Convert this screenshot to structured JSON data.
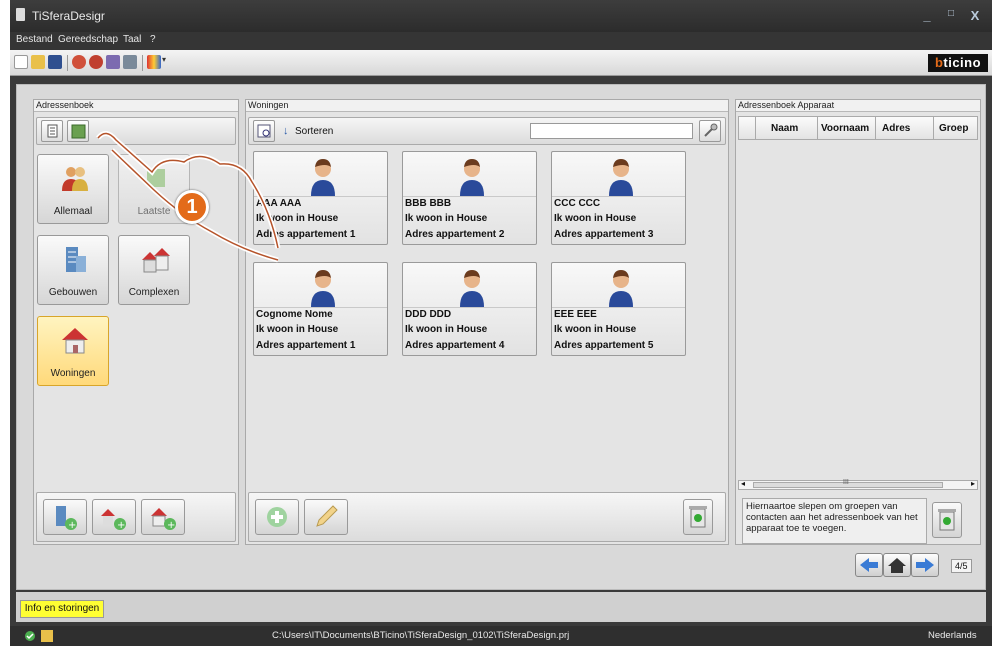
{
  "window": {
    "title": "TiSferaDesigr",
    "minimize": "_",
    "maximize": "□",
    "close": "X"
  },
  "menu": [
    "Bestand",
    "Gereedschap",
    "Taal",
    "?"
  ],
  "brand": {
    "prefix": "b",
    "rest": "ticino",
    "accent": "#e36b1a"
  },
  "left_panel": {
    "title": "Adressenboek",
    "categories": [
      {
        "label": "Allemaal",
        "icon": "people-icon"
      },
      {
        "label": "Laatste",
        "icon": "recent-icon"
      },
      {
        "label": "Gebouwen",
        "icon": "building-icon"
      },
      {
        "label": "Complexen",
        "icon": "complex-icon"
      },
      {
        "label": "Woningen",
        "icon": "house-icon",
        "selected": true
      }
    ]
  },
  "middle_panel": {
    "title": "Woningen",
    "sort_label": "Sorteren",
    "search_value": "",
    "cards": [
      {
        "name": "AAA AAA",
        "line2": "Ik woon in House",
        "line3": "Adres appartement 1"
      },
      {
        "name": "BBB BBB",
        "line2": "Ik woon in House",
        "line3": "Adres appartement 2"
      },
      {
        "name": "CCC CCC",
        "line2": "Ik woon in House",
        "line3": "Adres appartement 3"
      },
      {
        "name": "Cognome Nome",
        "line2": "Ik woon in House",
        "line3": "Adres appartement 1"
      },
      {
        "name": "DDD DDD",
        "line2": "Ik woon in House",
        "line3": "Adres appartement 4"
      },
      {
        "name": "EEE EEE",
        "line2": "Ik woon in House",
        "line3": "Adres appartement 5"
      }
    ]
  },
  "right_panel": {
    "title": "Adressenboek Apparaat",
    "columns": [
      "Naam",
      "Voornaam",
      "Adres",
      "Groep"
    ],
    "hint": "Hiernaartoe slepen om groepen van contacten aan het adressenboek van het apparaat toe te voegen.",
    "scroll_mark": "III"
  },
  "pager": "4/5",
  "callout": "1",
  "info_button": "Info en storingen",
  "status": {
    "path": "C:\\Users\\IT\\Documents\\BTicino\\TiSferaDesign_0102\\TiSferaDesign.prj",
    "language": "Nederlands"
  },
  "colors": {
    "selected_bg": "#ffd97a",
    "info_bg": "#ffff33",
    "titlebar": "#2c2c2c"
  }
}
